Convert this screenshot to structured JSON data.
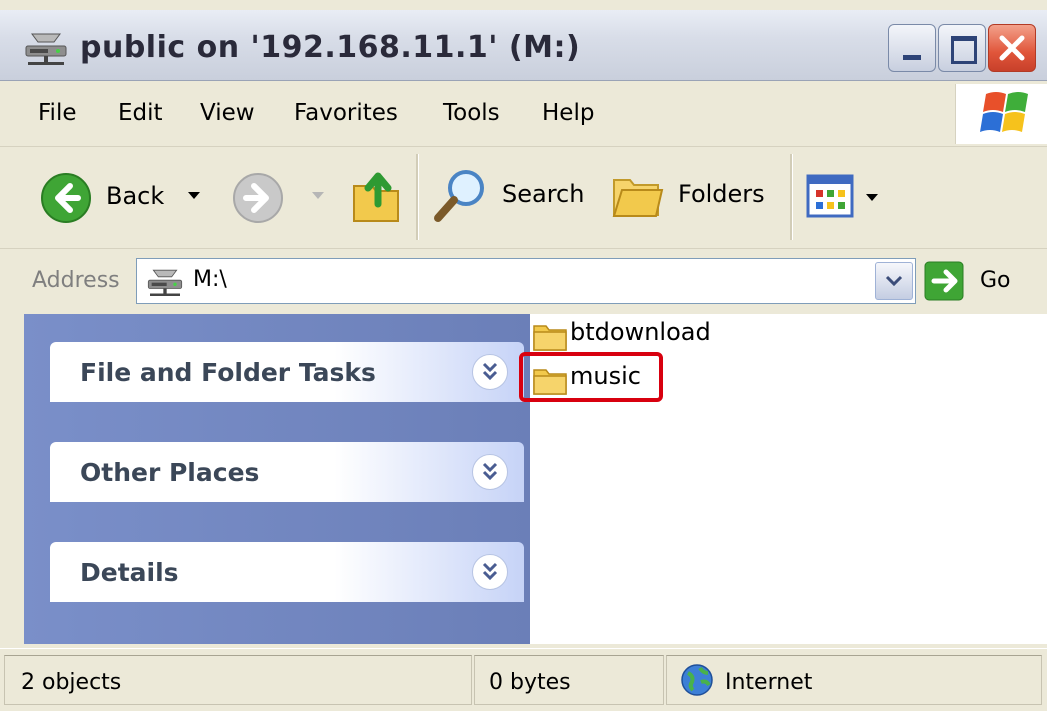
{
  "window": {
    "title": "public on '192.168.11.1' (M:)"
  },
  "menu": {
    "items": [
      "File",
      "Edit",
      "View",
      "Favorites",
      "Tools",
      "Help"
    ]
  },
  "toolbar": {
    "back_label": "Back",
    "search_label": "Search",
    "folders_label": "Folders"
  },
  "address": {
    "label": "Address",
    "value": "M:\\",
    "go_label": "Go"
  },
  "tasks": {
    "panels": [
      "File and Folder Tasks",
      "Other Places",
      "Details"
    ]
  },
  "files": {
    "items": [
      "btdownload",
      "music"
    ],
    "highlighted": "music"
  },
  "status": {
    "objects": "2 objects",
    "size": "0 bytes",
    "zone": "Internet"
  },
  "colors": {
    "highlight": "#d8000f",
    "task_pane": "#7a8fc9",
    "chrome": "#ECE9D8"
  },
  "icons": {
    "title": "network-drive-icon",
    "back": "back-arrow-icon",
    "forward": "forward-arrow-icon",
    "up": "folder-up-icon",
    "search": "magnifier-icon",
    "folders": "folders-icon",
    "views": "views-icon",
    "go": "go-arrow-icon",
    "zone": "internet-globe-icon"
  }
}
